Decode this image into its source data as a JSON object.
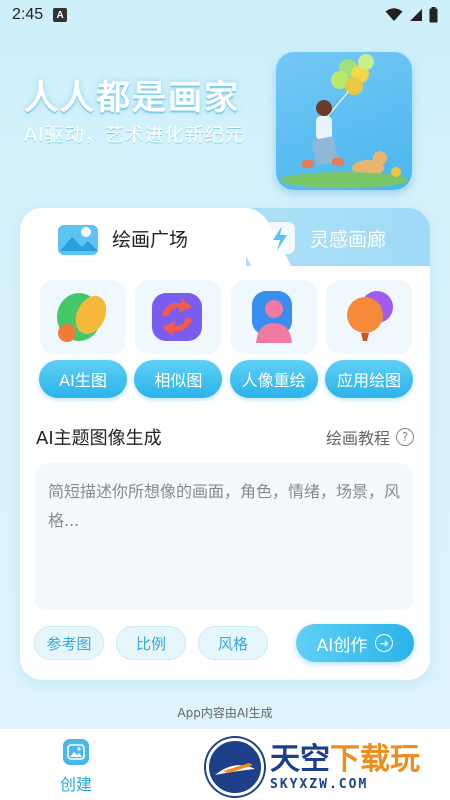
{
  "status_bar": {
    "time": "2:45",
    "badge": "A"
  },
  "hero": {
    "title": "人人都是画家",
    "subtitle": "AI驱动，艺术进化新纪元"
  },
  "tabs": [
    {
      "label": "绘画广场",
      "active": true
    },
    {
      "label": "灵感画廊",
      "active": false
    }
  ],
  "tools": [
    {
      "label": "AI生图",
      "icon": "brush-palette-icon"
    },
    {
      "label": "相似图",
      "icon": "refresh-arrows-icon"
    },
    {
      "label": "人像重绘",
      "icon": "person-icon"
    },
    {
      "label": "应用绘图",
      "icon": "balloon-icon"
    }
  ],
  "section": {
    "title": "AI主题图像生成",
    "tutorial": "绘画教程",
    "help": "?"
  },
  "prompt": {
    "placeholder": "简短描述你所想像的画面，角色，情绪，场景，风格..."
  },
  "chips": [
    "参考图",
    "比例",
    "风格"
  ],
  "create_button": "AI创作",
  "disclaimer": "App内容由AI生成",
  "bottom_nav": {
    "create_label": "创建"
  },
  "watermark": {
    "cn_part1": "天空",
    "cn_part2": "下载玩",
    "en": "SKYXZW.COM"
  },
  "colors": {
    "accent": "#2bb3ea",
    "accent_light": "#5fd0f6",
    "card": "#ffffff"
  }
}
